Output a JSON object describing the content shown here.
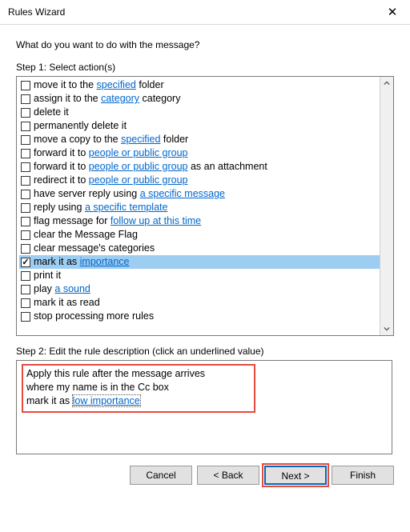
{
  "title": "Rules Wizard",
  "prompt": "What do you want to do with the message?",
  "step1_label": "Step 1: Select action(s)",
  "step2_label": "Step 2: Edit the rule description (click an underlined value)",
  "actions": [
    {
      "checked": false,
      "selected": false,
      "parts": [
        [
          "move it to the ",
          "plain"
        ],
        [
          "specified",
          "link"
        ],
        [
          " folder",
          "plain"
        ]
      ]
    },
    {
      "checked": false,
      "selected": false,
      "parts": [
        [
          "assign it to the ",
          "plain"
        ],
        [
          "category",
          "link"
        ],
        [
          " category",
          "plain"
        ]
      ]
    },
    {
      "checked": false,
      "selected": false,
      "parts": [
        [
          "delete it",
          "plain"
        ]
      ]
    },
    {
      "checked": false,
      "selected": false,
      "parts": [
        [
          "permanently delete it",
          "plain"
        ]
      ]
    },
    {
      "checked": false,
      "selected": false,
      "parts": [
        [
          "move a copy to the ",
          "plain"
        ],
        [
          "specified",
          "link"
        ],
        [
          " folder",
          "plain"
        ]
      ]
    },
    {
      "checked": false,
      "selected": false,
      "parts": [
        [
          "forward it to ",
          "plain"
        ],
        [
          "people or public group",
          "link"
        ]
      ]
    },
    {
      "checked": false,
      "selected": false,
      "parts": [
        [
          "forward it to ",
          "plain"
        ],
        [
          "people or public group",
          "link"
        ],
        [
          " as an attachment",
          "plain"
        ]
      ]
    },
    {
      "checked": false,
      "selected": false,
      "parts": [
        [
          "redirect it to ",
          "plain"
        ],
        [
          "people or public group",
          "link"
        ]
      ]
    },
    {
      "checked": false,
      "selected": false,
      "parts": [
        [
          "have server reply using ",
          "plain"
        ],
        [
          "a specific message",
          "link"
        ]
      ]
    },
    {
      "checked": false,
      "selected": false,
      "parts": [
        [
          "reply using ",
          "plain"
        ],
        [
          "a specific template",
          "link"
        ]
      ]
    },
    {
      "checked": false,
      "selected": false,
      "parts": [
        [
          "flag message for ",
          "plain"
        ],
        [
          "follow up at this time",
          "link"
        ]
      ]
    },
    {
      "checked": false,
      "selected": false,
      "parts": [
        [
          "clear the Message Flag",
          "plain"
        ]
      ]
    },
    {
      "checked": false,
      "selected": false,
      "parts": [
        [
          "clear message's categories",
          "plain"
        ]
      ]
    },
    {
      "checked": true,
      "selected": true,
      "parts": [
        [
          "mark it as ",
          "plain"
        ],
        [
          "importance",
          "link"
        ]
      ]
    },
    {
      "checked": false,
      "selected": false,
      "parts": [
        [
          "print it",
          "plain"
        ]
      ]
    },
    {
      "checked": false,
      "selected": false,
      "parts": [
        [
          "play ",
          "plain"
        ],
        [
          "a sound",
          "link"
        ]
      ]
    },
    {
      "checked": false,
      "selected": false,
      "parts": [
        [
          "mark it as read",
          "plain"
        ]
      ]
    },
    {
      "checked": false,
      "selected": false,
      "parts": [
        [
          "stop processing more rules",
          "plain"
        ]
      ]
    }
  ],
  "description": {
    "line1": "Apply this rule after the message arrives",
    "line2": "where my name is in the Cc box",
    "line3_prefix": "mark it as ",
    "line3_link": "low importance"
  },
  "buttons": {
    "cancel": "Cancel",
    "back": "< Back",
    "next": "Next >",
    "finish": "Finish"
  }
}
